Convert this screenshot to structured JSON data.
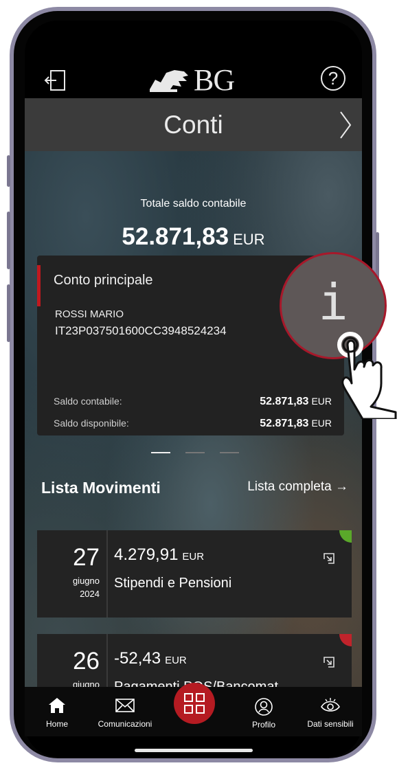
{
  "header": {
    "title": "Conti",
    "logo_text": "BG"
  },
  "summary": {
    "label": "Totale saldo contabile",
    "amount": "52.871,83",
    "currency": "EUR"
  },
  "account_card": {
    "name": "Conto principale",
    "holder": "ROSSI MARIO",
    "iban": "IT23P037501600CC3948524234",
    "rows": [
      {
        "label": "Saldo contabile:",
        "value": "52.871,83",
        "currency": "EUR"
      },
      {
        "label": "Saldo disponibile:",
        "value": "52.871,83",
        "currency": "EUR"
      }
    ]
  },
  "movements": {
    "title": "Lista Movimenti",
    "link": "Lista completa →",
    "items": [
      {
        "day": "27",
        "month": "giugno",
        "year": "2024",
        "amount": "4.279,91",
        "currency": "EUR",
        "description": "Stipendi e Pensioni",
        "flag_color": "#5aa82a"
      },
      {
        "day": "26",
        "month": "giugno",
        "year": "",
        "amount": "-52,43",
        "currency": "EUR",
        "description": "Pagamenti POS/Bancomat",
        "flag_color": "#c0232b"
      }
    ]
  },
  "highlight": {
    "glyph": "i"
  },
  "nav": {
    "items": [
      {
        "label": "Home",
        "icon": "home-icon"
      },
      {
        "label": "Comunicazioni",
        "icon": "envelope-icon"
      },
      {
        "label": "Profilo",
        "icon": "user-icon"
      },
      {
        "label": "Dati sensibili",
        "icon": "eye-icon"
      }
    ],
    "center_icon": "grid-icon"
  },
  "colors": {
    "accent": "#b51b22",
    "card_bg": "#222222",
    "positive_flag": "#5aa82a",
    "negative_flag": "#c0232b"
  }
}
